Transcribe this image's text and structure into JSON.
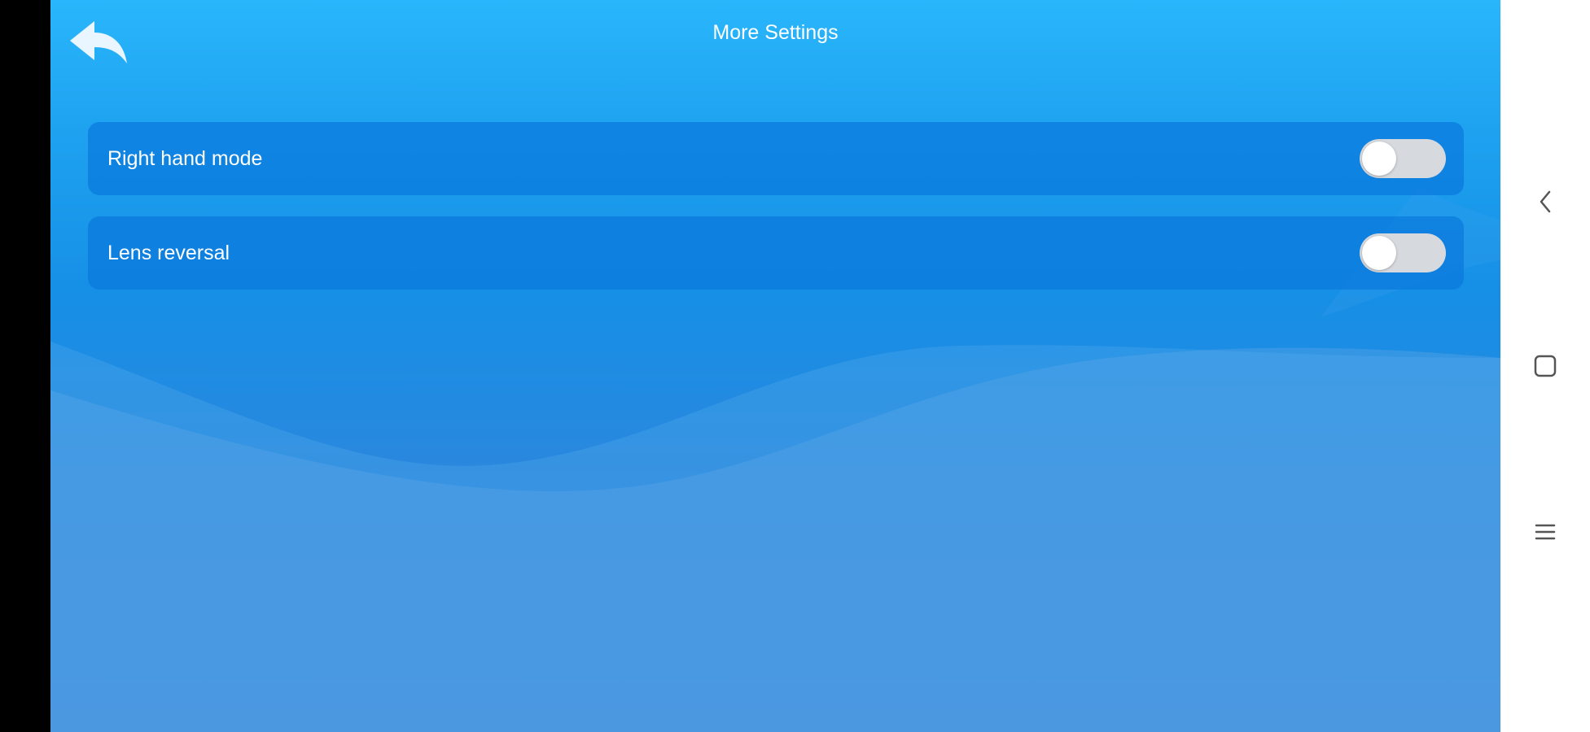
{
  "header": {
    "title": "More Settings",
    "back_icon": "reply-arrow-icon"
  },
  "settings": {
    "items": [
      {
        "label": "Right hand mode",
        "enabled": false
      },
      {
        "label": "Lens reversal",
        "enabled": false
      }
    ]
  },
  "system_nav": {
    "back_icon": "chevron-left-icon",
    "home_icon": "square-icon",
    "menu_icon": "menu-lines-icon"
  },
  "colors": {
    "background_top": "#29b6fb",
    "background_bottom": "#3a83d7",
    "row_background": "#0a78dc",
    "toggle_off": "#d6d9de",
    "nav_icon": "#555555"
  }
}
